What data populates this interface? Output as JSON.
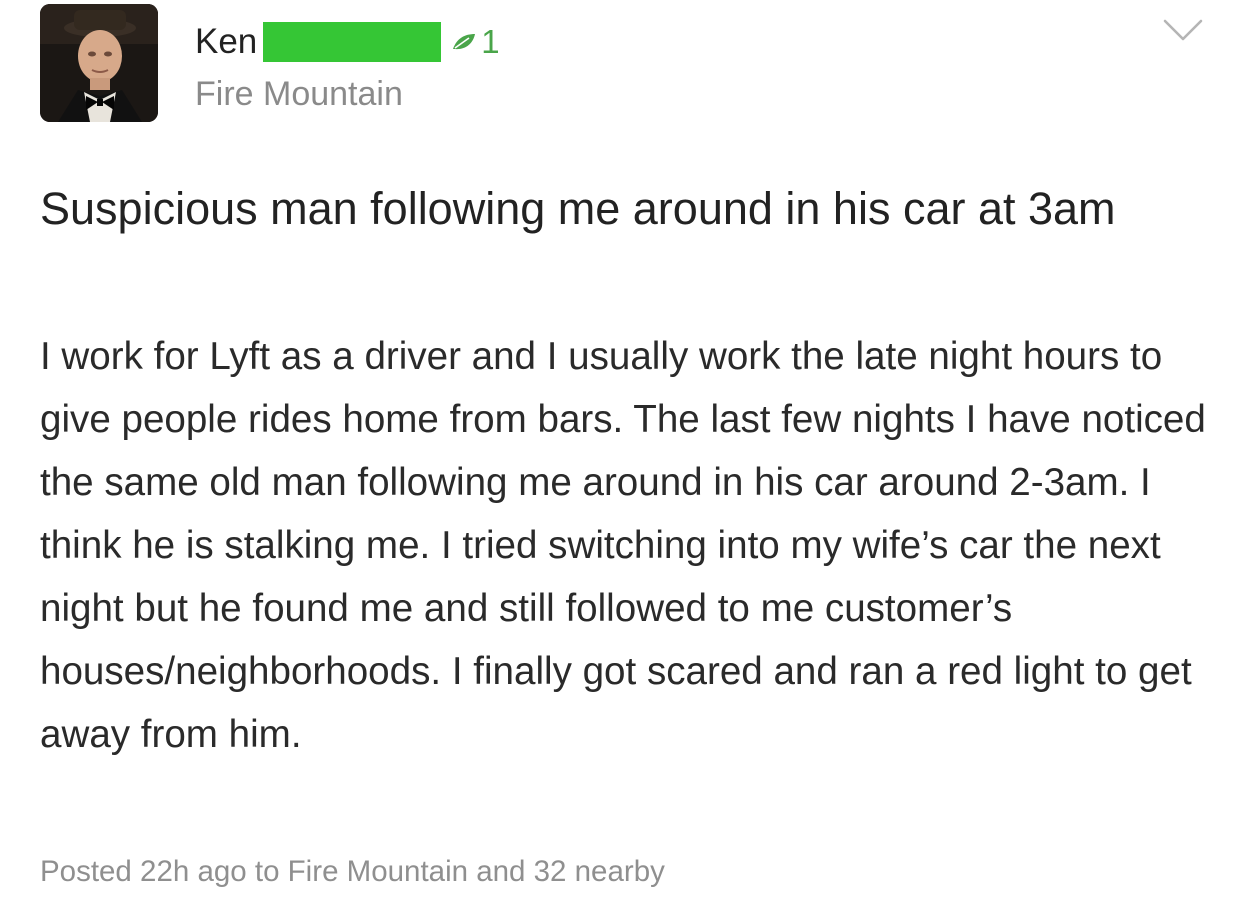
{
  "author": {
    "name": "Ken",
    "agree_count": "1",
    "neighborhood": "Fire Mountain"
  },
  "post": {
    "title": "Suspicious man following me around in his car at 3am",
    "body": "I work for Lyft as a driver and I usually work the late night hours to give people rides home from bars. The last few nights I have noticed the same old man following me around in his car around 2-3am. I think he is stalking me. I tried switching into my wife’s car the next night but he found me and still followed to me customer’s houses/neighborhoods. I finally got scared and ran a red light to get away from him.",
    "meta": "Posted 22h ago to Fire Mountain and 32 nearby"
  },
  "icons": {
    "agree": "leaf-icon",
    "menu": "chevron-down-icon"
  },
  "colors": {
    "redaction": "#35c635",
    "agree_accent": "#4aa54a",
    "secondary_text": "#8a8a8a"
  }
}
